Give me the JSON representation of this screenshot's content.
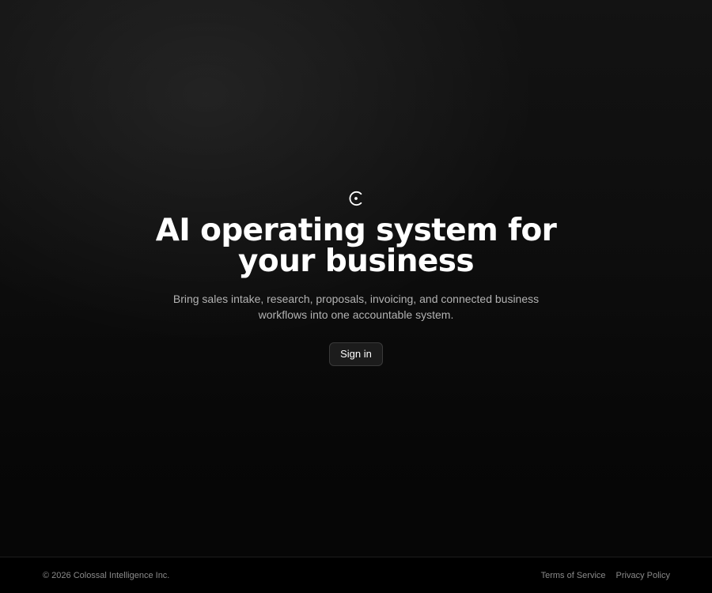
{
  "hero": {
    "logo_icon": "circle-dot-logo-icon",
    "headline": "AI operating system for your business",
    "subtitle": "Bring sales intake, research, proposals, invoicing, and connected business workflows into one accountable system.",
    "signin_label": "Sign in"
  },
  "footer": {
    "copyright": "© 2026 Colossal Intelligence Inc.",
    "links": [
      {
        "label": "Terms of Service"
      },
      {
        "label": "Privacy Policy"
      }
    ]
  },
  "colors": {
    "background": "#0d0d0d",
    "text": "#ffffff",
    "muted_text": "#b3b3b3",
    "button_bg": "#1c1c1c",
    "button_border": "#3a3a3a"
  }
}
